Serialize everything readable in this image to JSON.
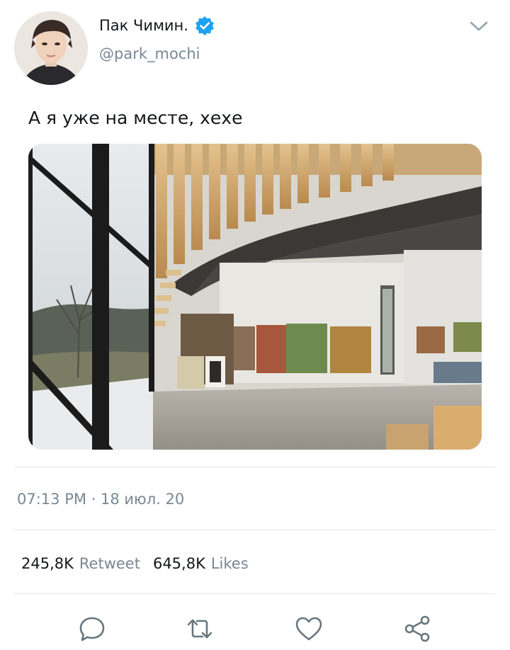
{
  "user": {
    "name": "Пак Чимин.",
    "handle": "@park_mochi",
    "verified": true
  },
  "tweet": {
    "text": "А я уже на месте, хехе",
    "timestamp": "07:13 PM · 18 июл. 20"
  },
  "stats": {
    "retweets_count": "245,8K",
    "retweets_label": "Retweet",
    "likes_count": "645,8K",
    "likes_label": "Likes"
  },
  "actions": [
    "reply-icon",
    "retweet-icon",
    "like-icon",
    "share-icon"
  ],
  "colors": {
    "verified_badge": "#1da1f2",
    "secondary_text": "#7a8793",
    "divider": "#e1e5ea"
  }
}
